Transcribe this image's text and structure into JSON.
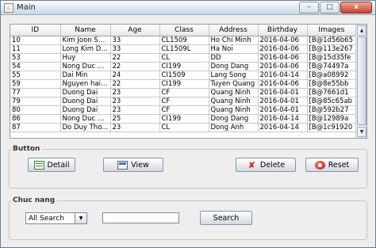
{
  "window": {
    "title": "Main",
    "app_icon": "java-cup-icon"
  },
  "table": {
    "columns": [
      "ID",
      "Name",
      "Age",
      "Class",
      "Address",
      "Birthday",
      "Images"
    ],
    "rows": [
      [
        "10",
        "Kim Joon Shin",
        "33",
        "CL1509",
        "Ho Chi Minh",
        "2016-04-06",
        "[B@1d56b65"
      ],
      [
        "11",
        "Long Kim Du...",
        "33",
        "CL1509L",
        "Ha Noi",
        "2016-04-06",
        "[B@113e267"
      ],
      [
        "53",
        "Huy",
        "22",
        "CL",
        "DD",
        "2016-04-06",
        "[B@15d35fe"
      ],
      [
        "54",
        "Nong Duc Huy",
        "22",
        "CI199",
        "Dong Dang",
        "2016-04-06",
        "[B@74497a"
      ],
      [
        "55",
        "Dai Min",
        "24",
        "CI1509",
        "Lang Song",
        "2016-04-14",
        "[B@a08992"
      ],
      [
        "59",
        "Nguyen hai ...",
        "22",
        "CI199",
        "Tuyen Quang",
        "2016-04-06",
        "[B@8e55bb"
      ],
      [
        "77",
        "Duong Dai",
        "23",
        "CF",
        "Quang Ninh",
        "2016-04-01",
        "[B@7661d1"
      ],
      [
        "79",
        "Duong Dai",
        "23",
        "CF",
        "Quang Ninh",
        "2016-04-01",
        "[B@85c65ab"
      ],
      [
        "80",
        "Duong Dai",
        "23",
        "CF",
        "Quang Ninh",
        "2016-04-01",
        "[B@592b27"
      ],
      [
        "86",
        "Nong Duc H...",
        "25",
        "CI199",
        "Dong Dang",
        "2016-04-14",
        "[B@12989a"
      ],
      [
        "87",
        "Do Duy Tho...",
        "23",
        "CL",
        "Dong Anh",
        "2016-04-14",
        "[B@1c91920"
      ]
    ]
  },
  "group_button": {
    "legend": "Button",
    "detail_label": "Detail",
    "view_label": "View",
    "delete_label": "Delete",
    "reset_label": "Reset"
  },
  "group_chuc_nang": {
    "legend": "Chuc nang",
    "search_type_value": "All Search",
    "search_text_value": "",
    "search_label": "Search"
  },
  "colors": {
    "title_bar": "#dfe7f1",
    "close_button": "#c7412b",
    "panel": "#eeeeee"
  }
}
